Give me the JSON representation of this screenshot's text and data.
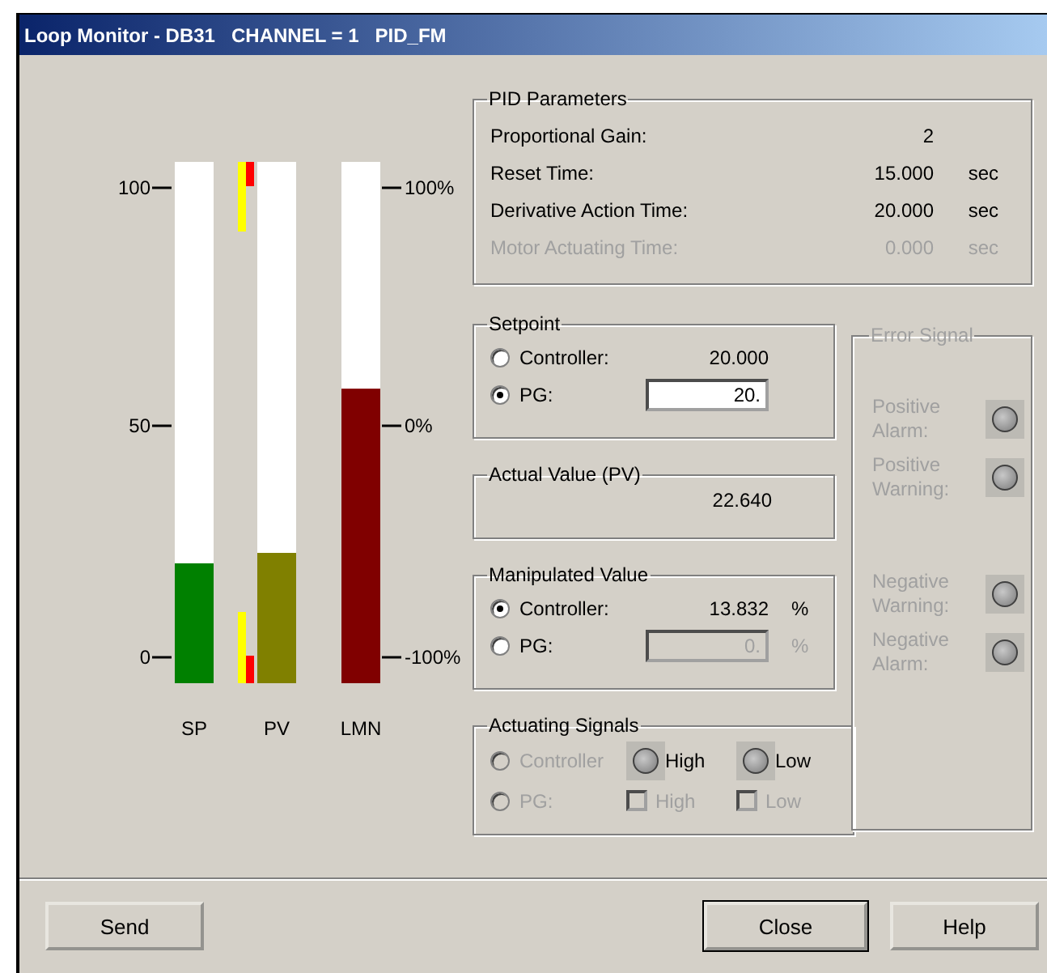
{
  "window": {
    "title": "Loop Monitor - DB31   CHANNEL = 1   PID_FM"
  },
  "gauges": {
    "left_ticks": [
      "100",
      "50",
      "0"
    ],
    "right_ticks": [
      "100%",
      "0%",
      "-100%"
    ],
    "bars": [
      {
        "label": "SP",
        "level": 0.23,
        "color": "#008000",
        "limits": false
      },
      {
        "label": "PV",
        "level": 0.25,
        "color": "#808000",
        "limits": true
      },
      {
        "label": "LMN",
        "level": 0.565,
        "color": "#800000",
        "limits": false
      }
    ]
  },
  "pid_parameters": {
    "title": "PID Parameters",
    "rows": [
      {
        "label": "Proportional Gain:",
        "value": "2",
        "disabled": false
      },
      {
        "label": "Reset Time:",
        "value": "15.000",
        "unit": "sec",
        "disabled": false
      },
      {
        "label": "Derivative Action Time:",
        "value": "20.000",
        "unit": "sec",
        "disabled": false
      },
      {
        "label": "Motor Actuating Time:",
        "value": "0.000",
        "unit": "sec",
        "disabled": true
      }
    ]
  },
  "setpoint": {
    "title": "Setpoint",
    "options": [
      {
        "label": "Controller:",
        "selected": false,
        "kind": "readout",
        "value": "20.000"
      },
      {
        "label": "PG:",
        "selected": true,
        "kind": "field",
        "value": "20.",
        "disabled": false
      }
    ]
  },
  "actual_value": {
    "title": "Actual Value (PV)",
    "value": "22.640"
  },
  "manipulated_value": {
    "title": "Manipulated Value",
    "options": [
      {
        "label": "Controller:",
        "selected": true,
        "kind": "readout",
        "value": "13.832",
        "unit": "%"
      },
      {
        "label": "PG:",
        "selected": false,
        "kind": "field",
        "value": "0.",
        "unit": "%",
        "disabled": true
      }
    ]
  },
  "actuating_signals": {
    "title": "Actuating Signals",
    "rows": [
      {
        "label": "Controller",
        "selected": false,
        "disabled": true,
        "kind": "lamps",
        "items": [
          {
            "label": "High"
          },
          {
            "label": "Low"
          }
        ]
      },
      {
        "label": "PG:",
        "selected": false,
        "disabled": true,
        "kind": "checkboxes",
        "items": [
          {
            "label": "High",
            "checked": false
          },
          {
            "label": "Low",
            "checked": false
          }
        ]
      }
    ]
  },
  "error_signal": {
    "title": "Error Signal",
    "disabled": true,
    "groups": [
      {
        "items": [
          {
            "label": "Positive Alarm:"
          },
          {
            "label": "Positive Warning:"
          }
        ]
      },
      {
        "items": [
          {
            "label": "Negative Warning:"
          },
          {
            "label": "Negative Alarm:"
          }
        ]
      }
    ]
  },
  "buttons": [
    {
      "label": "Send",
      "default": false
    },
    {
      "label": "Close",
      "default": true
    },
    {
      "label": "Help",
      "default": false
    }
  ]
}
